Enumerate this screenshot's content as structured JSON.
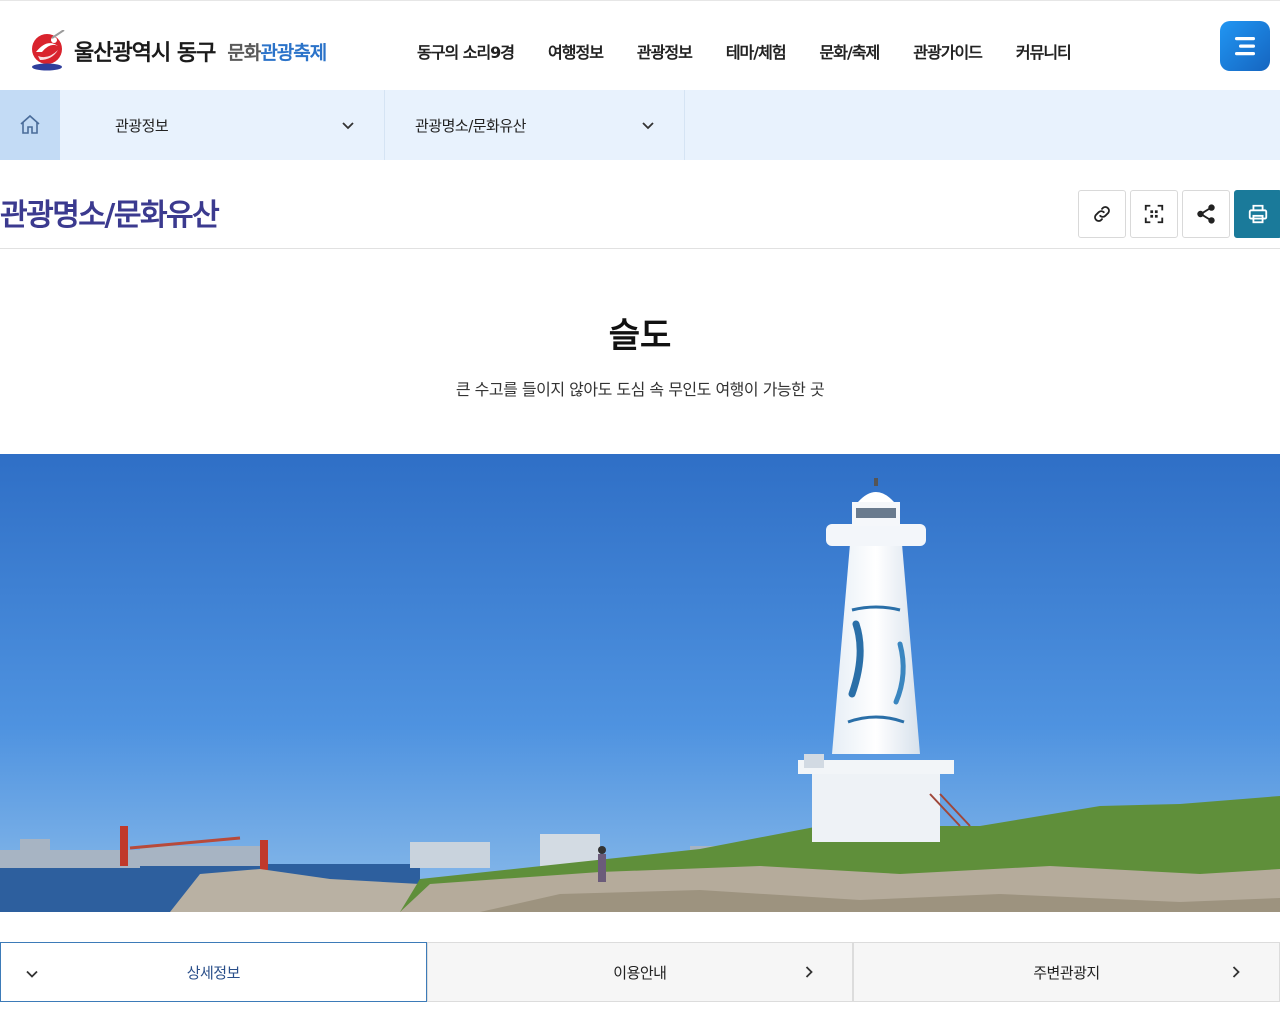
{
  "header": {
    "logo_title": "울산광역시 동구",
    "logo_sub_gray": "문화",
    "logo_sub_blue": "관광축제",
    "nav": [
      "동구의 소리9경",
      "여행정보",
      "관광정보",
      "테마/체험",
      "문화/축제",
      "관광가이드",
      "커뮤니티"
    ]
  },
  "location": {
    "level1": "관광정보",
    "level2": "관광명소/문화유산"
  },
  "page": {
    "title": "관광명소/문화유산"
  },
  "content": {
    "name": "슬도",
    "description": "큰 수고를 들이지 않아도 도심 속 무인도 여행이 가능한 곳"
  },
  "tabs": [
    {
      "label": "상세정보"
    },
    {
      "label": "이용안내"
    },
    {
      "label": "주변관광지"
    }
  ],
  "colors": {
    "accent_blue": "#1e88e5",
    "title_purple": "#3b3a8f",
    "location_bg": "#e8f2fd",
    "print_teal": "#1a7a9a"
  },
  "icons": [
    "home-icon",
    "chevron-down-icon",
    "link-icon",
    "qr-code-icon",
    "share-icon",
    "print-icon",
    "hamburger-icon",
    "chevron-right-icon"
  ]
}
